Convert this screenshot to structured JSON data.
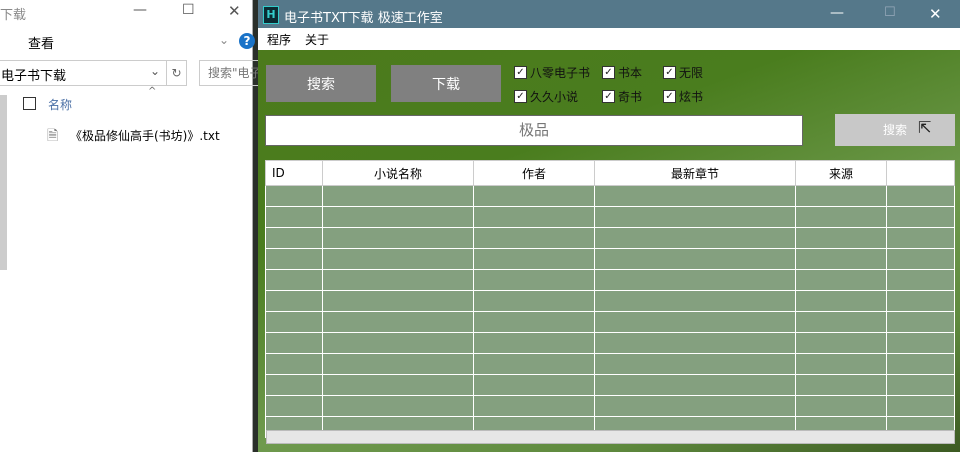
{
  "explorer": {
    "title": "下载",
    "view_menu": "查看",
    "address": "电子书下载",
    "search_placeholder": "搜索\"电子",
    "column_name": "名称",
    "files": [
      "《极品修仙高手(书坊)》.txt"
    ]
  },
  "app": {
    "title": "电子书TXT下载 极速工作室",
    "menu": [
      "程序",
      "关于"
    ],
    "search_button": "搜索",
    "download_button": "下载",
    "sources": [
      {
        "label": "八零电子书",
        "checked": true
      },
      {
        "label": "书本",
        "checked": true
      },
      {
        "label": "无限",
        "checked": true
      },
      {
        "label": "久久小说",
        "checked": true
      },
      {
        "label": "奇书",
        "checked": true
      },
      {
        "label": "炫书",
        "checked": true
      }
    ],
    "query": "极品",
    "query_search_button": "搜索",
    "columns": [
      "ID",
      "小说名称",
      "作者",
      "最新章节",
      "来源",
      ""
    ],
    "row_count": 12,
    "progress": 0
  }
}
